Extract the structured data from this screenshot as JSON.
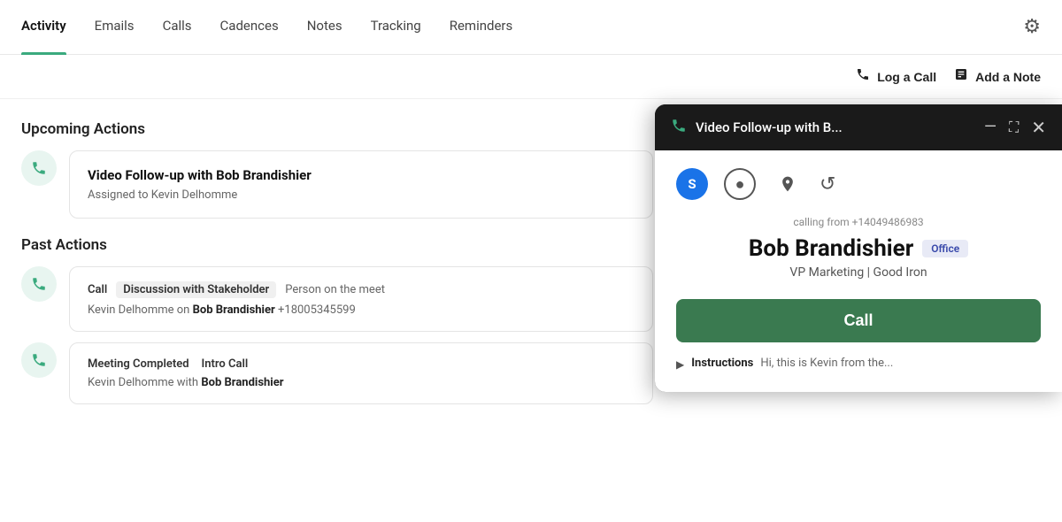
{
  "nav": {
    "tabs": [
      {
        "id": "activity",
        "label": "Activity",
        "active": true
      },
      {
        "id": "emails",
        "label": "Emails",
        "active": false
      },
      {
        "id": "calls",
        "label": "Calls",
        "active": false
      },
      {
        "id": "cadences",
        "label": "Cadences",
        "active": false
      },
      {
        "id": "notes",
        "label": "Notes",
        "active": false
      },
      {
        "id": "tracking",
        "label": "Tracking",
        "active": false
      },
      {
        "id": "reminders",
        "label": "Reminders",
        "active": false
      }
    ],
    "gear_icon": "⚙"
  },
  "action_bar": {
    "log_call_label": "Log a Call",
    "add_note_label": "Add a Note"
  },
  "upcoming_actions": {
    "title": "Upcoming Actions",
    "items": [
      {
        "title": "Video Follow-up with Bob Brandishier",
        "subtitle": "Assigned to Kevin Delhomme"
      }
    ]
  },
  "past_actions": {
    "title": "Past Actions",
    "items": [
      {
        "type": "Call",
        "badge": "Discussion with Stakeholder",
        "description": "Person on the meet",
        "footer": "Kevin Delhomme on Bob Brandishier  +18005345599"
      },
      {
        "type": "Meeting Completed",
        "badge": "Intro Call",
        "description": "",
        "footer": "Kevin Delhomme with Bob Brandishier"
      }
    ]
  },
  "popup": {
    "title": "Video Follow-up with B...",
    "calling_from": "calling from +14049486983",
    "contact_name": "Bob Brandishier",
    "contact_badge": "Office",
    "contact_title": "VP Marketing | Good Iron",
    "call_button_label": "Call",
    "instructions_label": "Instructions",
    "instructions_text": "Hi, this is Kevin from the...",
    "icons": {
      "s_label": "S",
      "circle_label": "○",
      "location_label": "📍",
      "refresh_label": "↺"
    }
  }
}
